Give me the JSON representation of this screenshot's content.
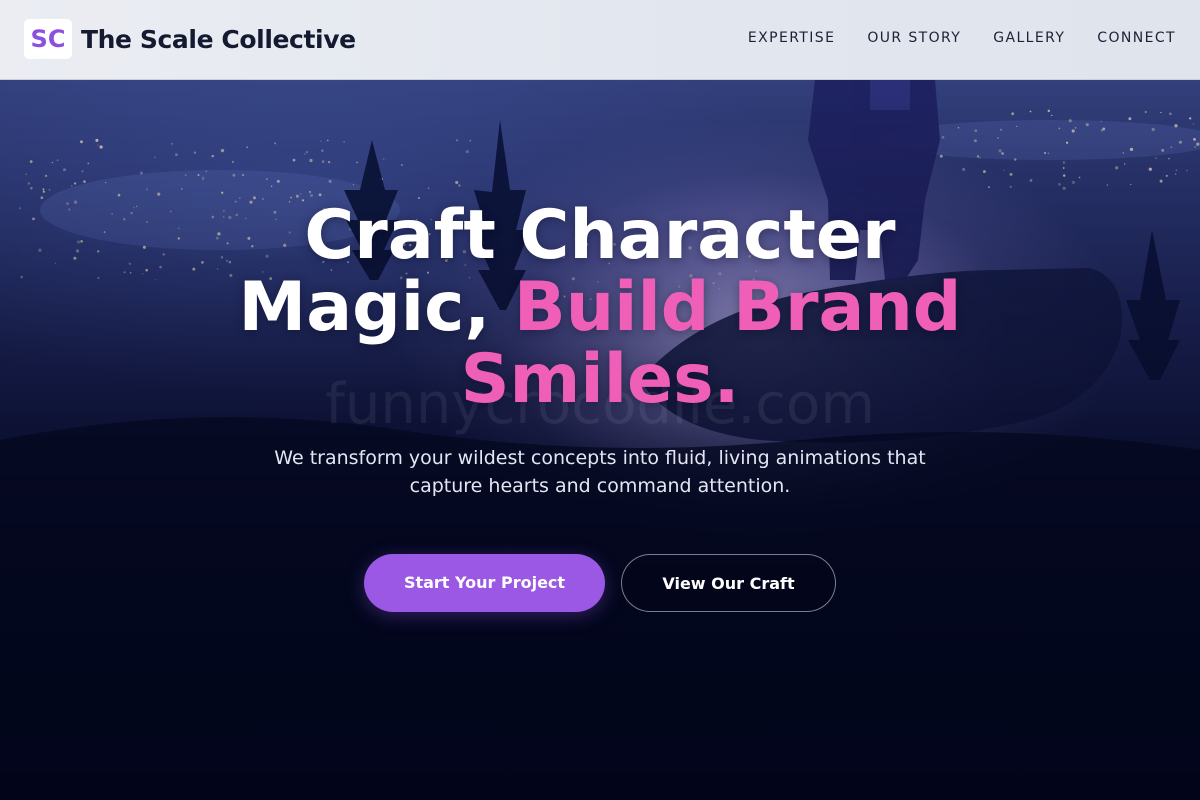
{
  "brand": {
    "logo_initials": "SC",
    "name": "The Scale Collective",
    "accent_color": "#8b50dd"
  },
  "nav": {
    "items": [
      {
        "label": "EXPERTISE"
      },
      {
        "label": "OUR STORY"
      },
      {
        "label": "GALLERY"
      },
      {
        "label": "CONNECT"
      }
    ]
  },
  "hero": {
    "headline_plain": "Craft Character Magic,",
    "headline_accent": "Build Brand Smiles.",
    "subtitle": "We transform your wildest concepts into fluid, living animations that capture hearts and command attention.",
    "primary_cta": "Start Your Project",
    "secondary_cta": "View Our Craft",
    "accent_color": "#ef5fb8",
    "primary_button_color": "#9a58e4"
  },
  "watermark": "funnycrocodile.com"
}
